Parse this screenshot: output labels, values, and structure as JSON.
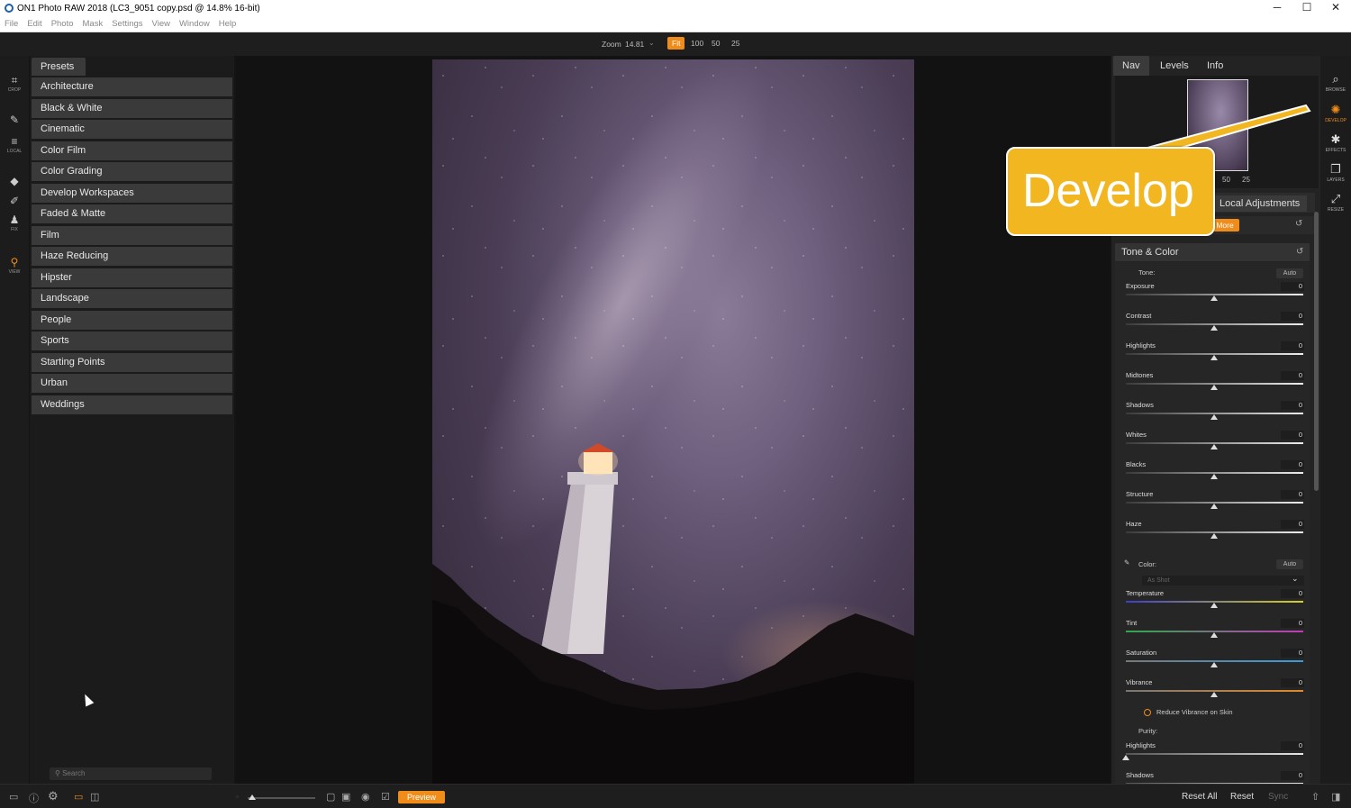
{
  "window": {
    "title": "ON1 Photo RAW 2018 (LC3_9051 copy.psd @ 14.8% 16-bit)",
    "minimize": "─",
    "maximize": "☐",
    "close": "✕"
  },
  "menu": [
    "File",
    "Edit",
    "Photo",
    "Mask",
    "Settings",
    "View",
    "Window",
    "Help"
  ],
  "topbar": {
    "zoom_label": "Zoom",
    "zoom_value": "14.81",
    "zoom_buttons": [
      "Fit",
      "100",
      "50",
      "25"
    ],
    "active_zoom": "Fit"
  },
  "left_tools": [
    {
      "icon": "crop-icon",
      "label": "CROP"
    },
    {
      "icon": "brush-icon",
      "label": ""
    },
    {
      "icon": "local-icon",
      "label": "LOCAL"
    },
    {
      "icon": "eraser-icon",
      "label": ""
    },
    {
      "icon": "retouch-icon",
      "label": ""
    },
    {
      "icon": "stamp-icon",
      "label": "FIX"
    },
    {
      "icon": "zoom-icon",
      "label": "VIEW"
    }
  ],
  "presets": {
    "tab_label": "Presets",
    "items": [
      "Architecture",
      "Black & White",
      "Cinematic",
      "Color Film",
      "Color Grading",
      "Develop Workspaces",
      "Faded & Matte",
      "Film",
      "Haze Reducing",
      "Hipster",
      "Landscape",
      "People",
      "Sports",
      "Starting Points",
      "Urban",
      "Weddings"
    ],
    "search_placeholder": "Search"
  },
  "right_panel": {
    "tabs": [
      "Nav",
      "Levels",
      "Info"
    ],
    "active_tab": "Nav",
    "nav_zoom": [
      "50",
      "25"
    ],
    "local_tab": "Local Adjustments",
    "more_button": "More",
    "tone_color": {
      "title": "Tone & Color",
      "tone_label": "Tone:",
      "auto_label": "Auto",
      "sliders": [
        {
          "label": "Exposure",
          "value": "0"
        },
        {
          "label": "Contrast",
          "value": "0"
        },
        {
          "label": "Highlights",
          "value": "0"
        },
        {
          "label": "Midtones",
          "value": "0"
        },
        {
          "label": "Shadows",
          "value": "0"
        },
        {
          "label": "Whites",
          "value": "0"
        },
        {
          "label": "Blacks",
          "value": "0"
        },
        {
          "label": "Structure",
          "value": "0"
        },
        {
          "label": "Haze",
          "value": "0"
        }
      ],
      "color_label": "Color:",
      "color_auto_label": "Auto",
      "white_balance": "As Shot",
      "color_sliders": [
        {
          "label": "Temperature",
          "value": "0"
        },
        {
          "label": "Tint",
          "value": "0"
        },
        {
          "label": "Saturation",
          "value": "0"
        },
        {
          "label": "Vibrance",
          "value": "0"
        }
      ],
      "reduce_vibrance": "Reduce Vibrance on Skin",
      "purity_label": "Purity:",
      "purity_sliders": [
        {
          "label": "Highlights",
          "value": "0"
        },
        {
          "label": "Shadows",
          "value": "0"
        }
      ]
    }
  },
  "modules": [
    {
      "icon": "browse-icon",
      "label": "BROWSE"
    },
    {
      "icon": "develop-icon",
      "label": "DEVELOP"
    },
    {
      "icon": "effects-icon",
      "label": "EFFECTS"
    },
    {
      "icon": "layers-icon",
      "label": "LAYERS"
    },
    {
      "icon": "resize-icon",
      "label": "RESIZE"
    }
  ],
  "active_module": "DEVELOP",
  "callout": {
    "text": "Develop",
    "color": "#f2b720"
  },
  "bottom": {
    "preview": "Preview",
    "reset_all": "Reset All",
    "reset": "Reset",
    "sync": "Sync"
  },
  "colors": {
    "accent": "#f08c1a",
    "panel": "#232323",
    "preset_item": "#3a3a3a"
  }
}
